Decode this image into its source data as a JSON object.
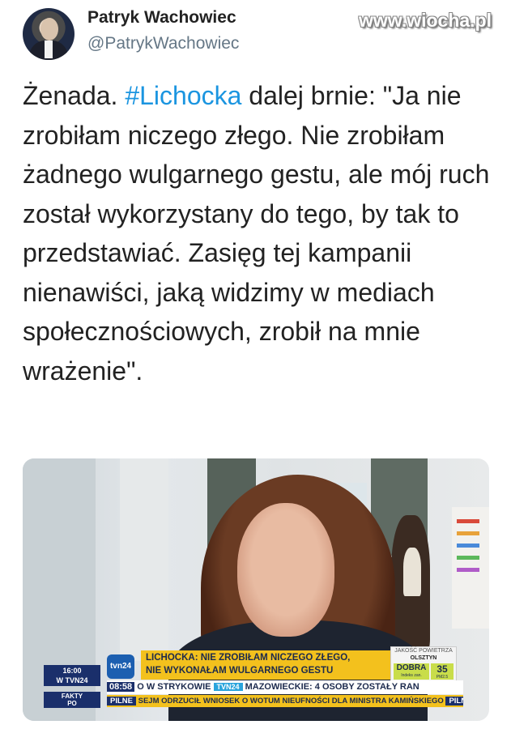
{
  "header": {
    "author_name": "Patryk Wachowiec",
    "author_handle": "@PatrykWachowiec",
    "watermark": "www.wiocha.pl"
  },
  "tweet": {
    "text_prefix": "Żenada. ",
    "hashtag": "#Lichocka",
    "text_suffix": " dalej brnie: \"Ja nie zrobiłam niczego złego. Nie zrobiłam żadnego wulgarnego gestu, ale mój ruch został wykorzystany do tego, by tak to przedstawiać. Zasięg tej kampanii nienawiści, jaką widzimy w mediach społecznościowych, zrobił na mnie wrażenie\"."
  },
  "media": {
    "banner_line1": "LICHOCKA: NIE ZROBIŁAM NICZEGO ZŁEGO,",
    "banner_line2": "NIE WYKONAŁAM WULGARNEGO GESTU",
    "logo": "tvn24",
    "clock_time": "16:00",
    "clock_channel": "W TVN24",
    "air_quality_title": "JAKOŚĆ POWIETRZA",
    "air_quality_city": "OLSZTYN",
    "air_quality_grade": "DOBRA",
    "air_quality_grade_sub": "Indeks zan.",
    "air_quality_value": "35",
    "air_quality_value_sub": "PM2.5",
    "ticker1_time": "08:58",
    "ticker1_text_a": "O W STRYKOWIE",
    "ticker1_chip": "TVN24",
    "ticker1_text_b": "MAZOWIECKIE: 4 OSOBY ZOSTAŁY RAN",
    "ticker2_pilne": "PILNE",
    "ticker2_text": "SEJM ODRZUCIŁ WNIOSEK O WOTUM NIEUFNOŚCI DLA MINISTRA KAMIŃSKIEGO",
    "ticker2_pilne_end": "PILNE",
    "fakty_line1": "FAKTY",
    "fakty_line2": "PO"
  },
  "colors": {
    "hashtag": "#1b95e0",
    "handle": "#657786",
    "banner": "#f3c11d",
    "tvn_navy": "#1a2f6b"
  }
}
